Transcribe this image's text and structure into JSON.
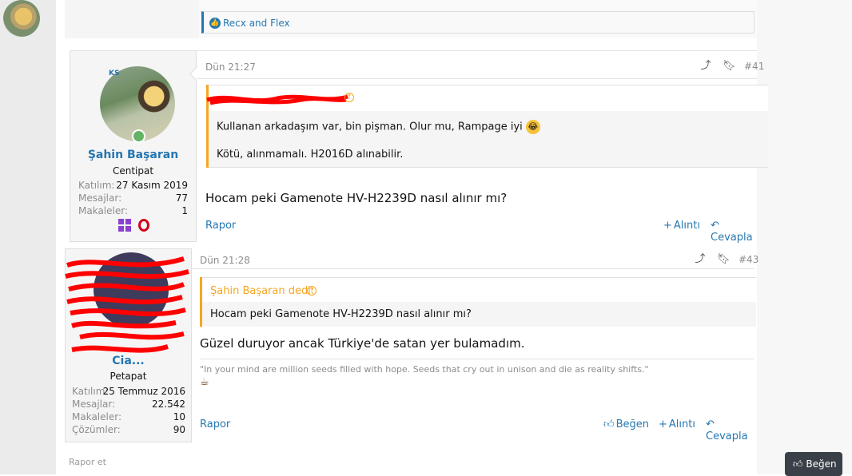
{
  "previous_post": {
    "reactions_text": "Recx and Flex"
  },
  "post1": {
    "author": {
      "avatar_badge": "KS",
      "name": "Şahin Başaran",
      "title": "Centipat",
      "stats": [
        {
          "label": "Katılım:",
          "value": "27 Kasım 2019"
        },
        {
          "label": "Mesajlar:",
          "value": "77"
        },
        {
          "label": "Makaleler:",
          "value": "1"
        }
      ],
      "device_icons": [
        "windows-icon",
        "opera-icon"
      ],
      "online": true
    },
    "date": "Dün 21:27",
    "post_number": "#41",
    "quote": {
      "lines": [
        "Kullanan arkadaşım var, bin pişman. Olur mu, Rampage iyi",
        "Kötü, alınmamalı. H2016D alınabilir."
      ],
      "emoji": "rolling-laughing-emoji"
    },
    "message": "Hocam peki Gamenote HV-H2239D nasıl alınır mı?",
    "actions": {
      "report": "Rapor",
      "quote": "Alıntı",
      "reply": "Cevapla"
    }
  },
  "post2": {
    "author": {
      "name": "Cia...",
      "title": "Petapat",
      "stats": [
        {
          "label": "Katılım:",
          "value": "25 Temmuz 2016"
        },
        {
          "label": "Mesajlar:",
          "value": "22.542"
        },
        {
          "label": "Makaleler:",
          "value": "10"
        },
        {
          "label": "Çözümler:",
          "value": "90"
        }
      ]
    },
    "date": "Dün 21:28",
    "post_number": "#43",
    "quote": {
      "author": "Şahin Başaran dedi:",
      "text": "Hocam peki Gamenote HV-H2239D nasıl alınır mı?"
    },
    "message": "Güzel duruyor ancak Türkiye'de satan yer bulamadım.",
    "signature": "\"In your mind are million seeds filled with hope. Seeds that cry out in unison and die as reality shifts.\"",
    "actions": {
      "report": "Rapor",
      "like": "Beğen",
      "quote": "Alıntı",
      "reply": "Cevapla"
    }
  },
  "footer": {
    "report_label": "Rapor et",
    "floating_like": "Beğen"
  },
  "colors": {
    "link": "#2577b1",
    "quote_accent": "#f5a623",
    "redaction": "#ff0000"
  }
}
